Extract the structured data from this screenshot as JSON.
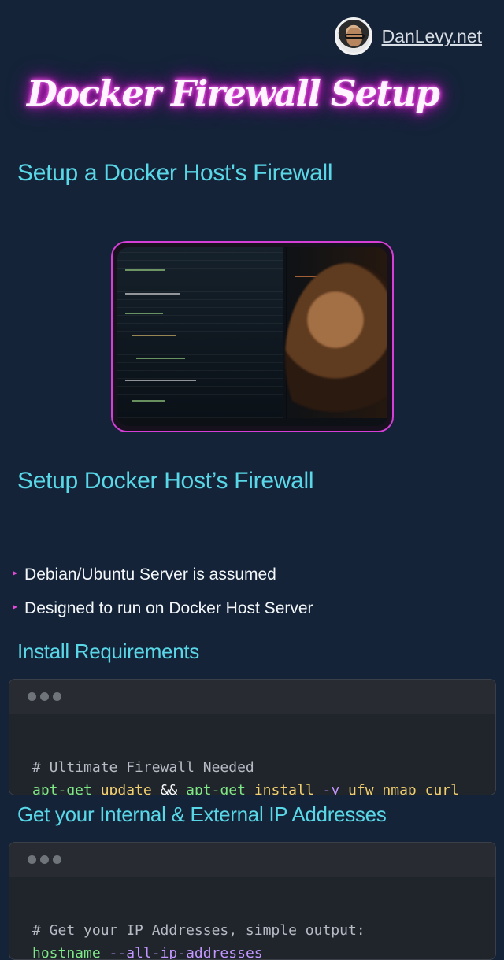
{
  "header": {
    "site_link": "DanLevy.net"
  },
  "title": "Docker Firewall Setup",
  "section_heading": "Setup a Docker Host's Firewall",
  "page_heading": "Setup Docker Host’s Firewall",
  "bullets": [
    "Debian/Ubuntu Server is assumed",
    "Designed to run on Docker Host Server"
  ],
  "sections": [
    {
      "heading": "Install Requirements",
      "comment": "# Ultimate Firewall Needed",
      "tokens": [
        "apt-get",
        "update",
        "&&",
        "apt-get",
        "install",
        "-y",
        "ufw",
        "nmap",
        "curl"
      ]
    },
    {
      "heading": "Get your Internal & External IP Addresses",
      "comment": "# Get your IP Addresses, simple output:",
      "tokens": [
        "hostname",
        "--all-ip-addresses"
      ]
    }
  ],
  "colors": {
    "background": "#142338",
    "accent": "#59d7e7",
    "neon": "#e92ad7",
    "terminal": "#20242b"
  },
  "icons": {
    "bullet": "triangle-right-icon",
    "avatar": "avatar-icon"
  }
}
